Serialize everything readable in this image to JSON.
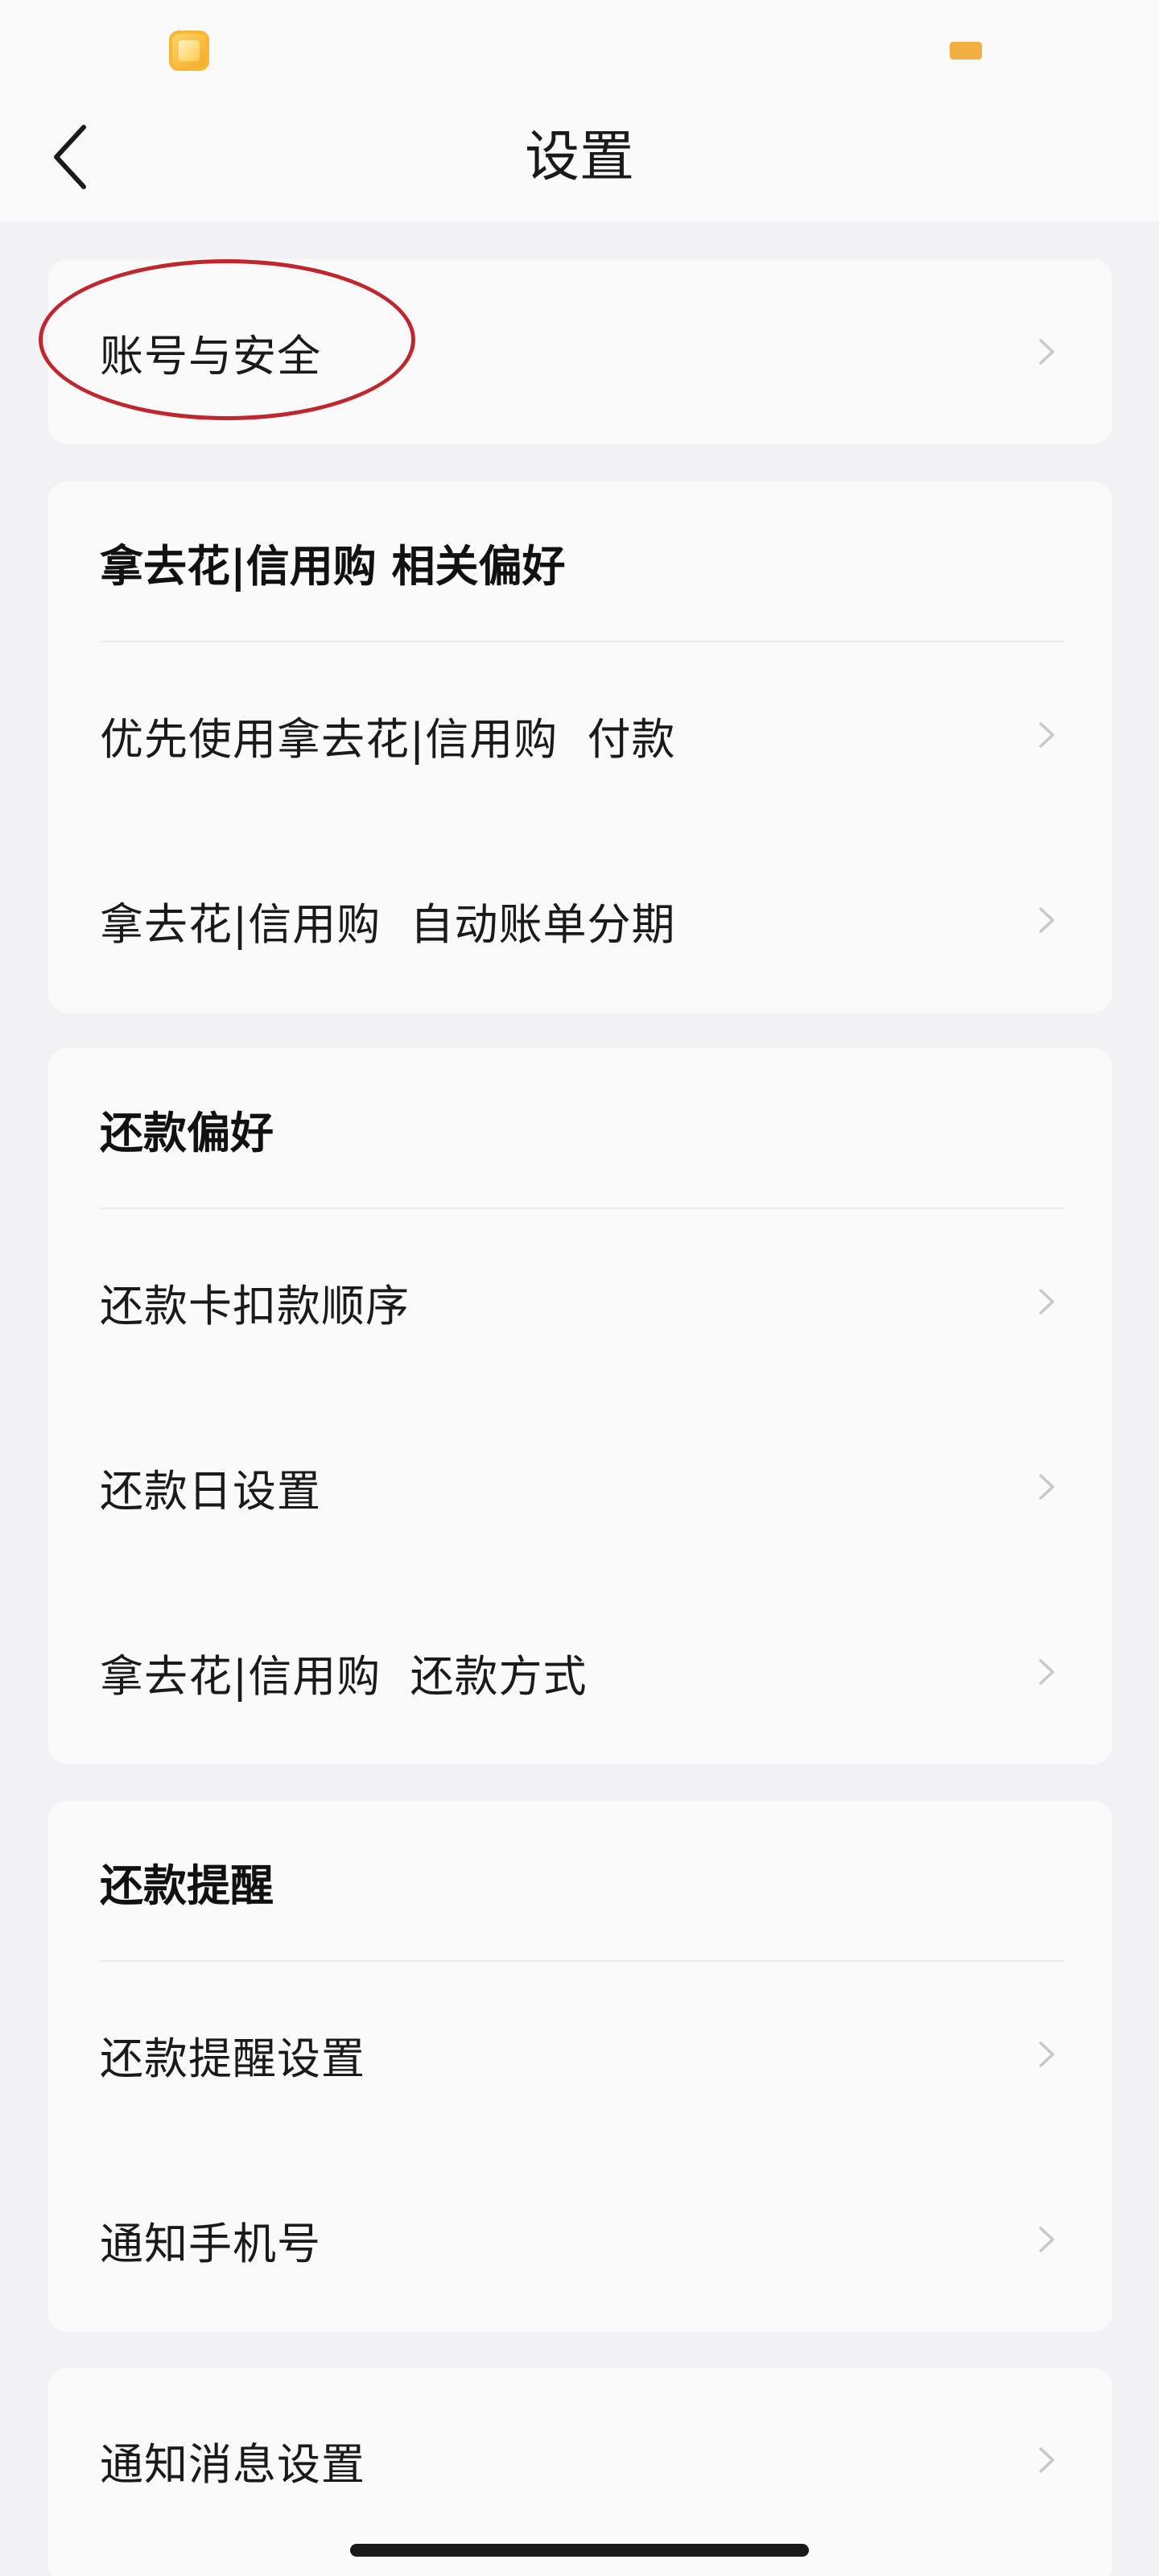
{
  "header": {
    "title": "设置"
  },
  "sections": [
    {
      "items": [
        {
          "label": "账号与安全"
        }
      ]
    },
    {
      "title": "拿去花|信用购 相关偏好",
      "items": [
        {
          "label": "优先使用拿去花|信用购  付款"
        },
        {
          "label": "拿去花|信用购  自动账单分期"
        }
      ]
    },
    {
      "title": "还款偏好",
      "items": [
        {
          "label": "还款卡扣款顺序"
        },
        {
          "label": "还款日设置"
        },
        {
          "label": "拿去花|信用购  还款方式"
        }
      ]
    },
    {
      "title": "还款提醒",
      "items": [
        {
          "label": "还款提醒设置"
        },
        {
          "label": "通知手机号"
        }
      ]
    },
    {
      "items": [
        {
          "label": "通知消息设置"
        }
      ]
    }
  ],
  "colors": {
    "background": "#F2F2F5",
    "card": "#FAFAFB",
    "text": "#1A1A1A",
    "chevron": "#C7C7CC",
    "annotation": "#C0262D",
    "app_icon": "#F5A623",
    "battery": "#F3B042"
  },
  "icons": {
    "back": "chevron-left-icon",
    "row_arrow": "chevron-right-icon",
    "app": "app-icon",
    "battery": "battery-icon"
  }
}
